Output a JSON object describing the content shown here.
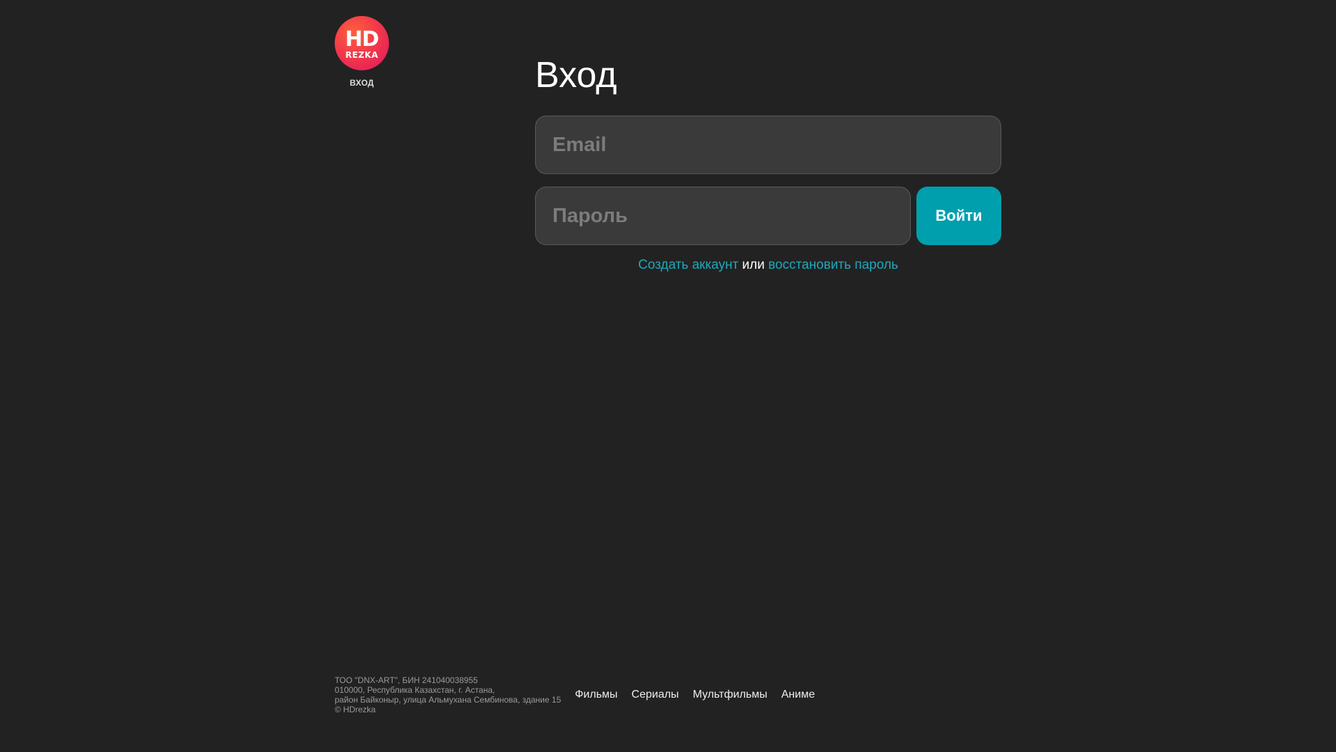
{
  "logo": {
    "line1": "HD",
    "line2": "REZKA",
    "caption": "вход"
  },
  "login": {
    "title": "Вход",
    "email_placeholder": "Email",
    "password_placeholder": "Пароль",
    "submit_label": "Войти",
    "create_account": "Создать аккаунт",
    "or": " или ",
    "restore_password": "восстановить пароль"
  },
  "footer": {
    "info_lines": [
      "ТОО \"DNX-ART\", БИН 241040038955",
      "010000, Республика Казахстан, г. Астана,",
      "район Байконыр, улица Альмухана Сембинова, здание 15",
      "© HDrezka"
    ],
    "nav": [
      "Фильмы",
      "Сериалы",
      "Мультфильмы",
      "Аниме"
    ]
  },
  "colors": {
    "background": "#222222",
    "accent": "#009fae",
    "link": "#1fa9bb",
    "logo_gradient_start": "#ff5f3a",
    "logo_gradient_end": "#e0155e"
  }
}
